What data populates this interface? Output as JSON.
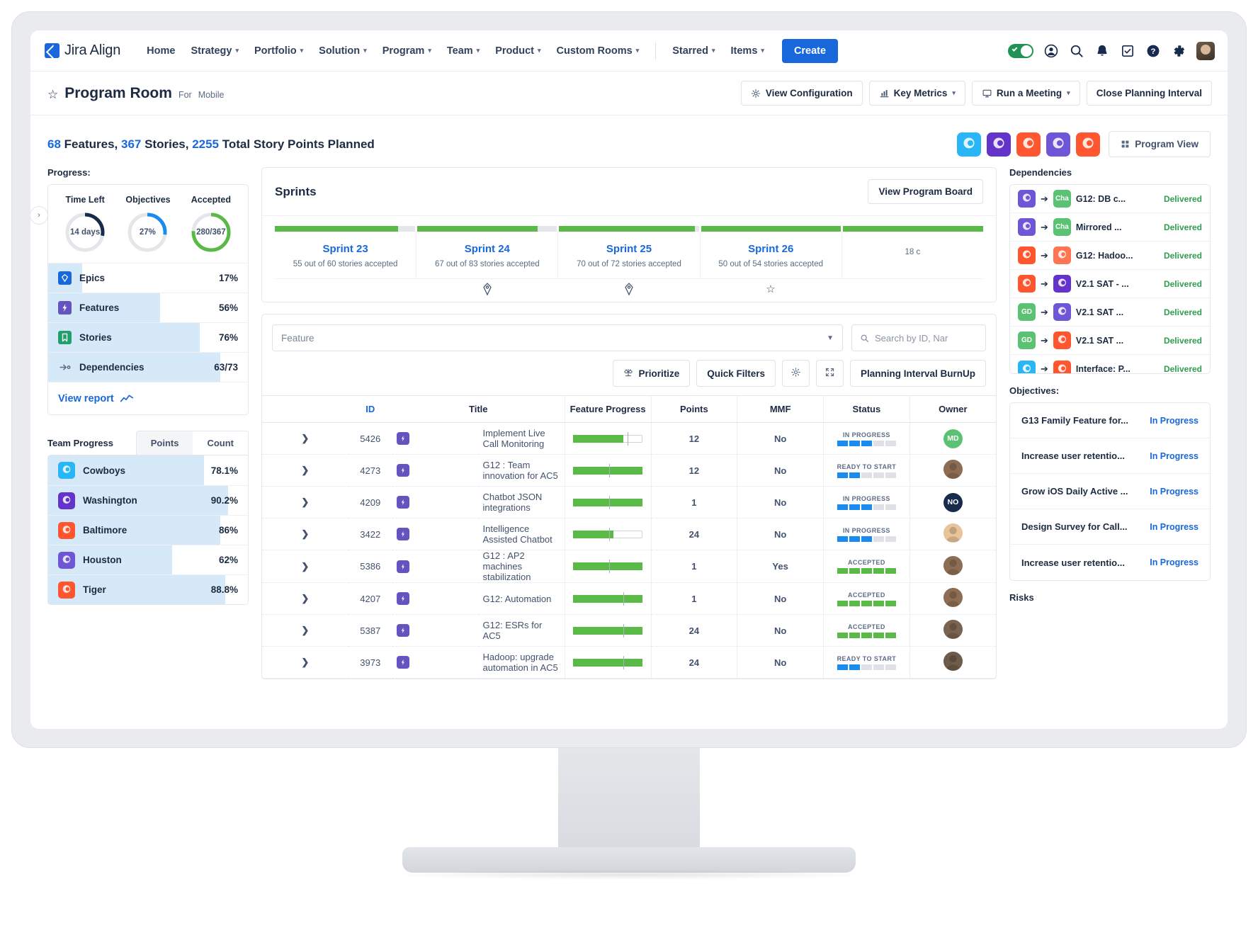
{
  "nav": {
    "brand": "Jira Align",
    "items": [
      {
        "label": "Home",
        "caret": false
      },
      {
        "label": "Strategy",
        "caret": true
      },
      {
        "label": "Portfolio",
        "caret": true
      },
      {
        "label": "Solution",
        "caret": true
      },
      {
        "label": "Program",
        "caret": true
      },
      {
        "label": "Team",
        "caret": true
      },
      {
        "label": "Product",
        "caret": true
      },
      {
        "label": "Custom Rooms",
        "caret": true
      }
    ],
    "items2": [
      {
        "label": "Starred",
        "caret": true
      },
      {
        "label": "Items",
        "caret": true
      }
    ],
    "create_label": "Create",
    "icons": [
      "toggle-switch",
      "account-icon",
      "search-icon",
      "notification-bell-icon",
      "tasks-checkbox-icon",
      "help-icon",
      "settings-gear-icon",
      "user-avatar"
    ]
  },
  "header": {
    "star_icon": "star-outline-icon",
    "title": "Program Room",
    "for_label": "For",
    "context": "Mobile",
    "actions": [
      {
        "label": "View Configuration",
        "icon": "gear-icon",
        "caret": false
      },
      {
        "label": "Key Metrics",
        "icon": "chart-icon",
        "caret": true
      },
      {
        "label": "Run a Meeting",
        "icon": "monitor-icon",
        "caret": true
      },
      {
        "label": "Close Planning Interval",
        "icon": "",
        "caret": false
      }
    ]
  },
  "summary": {
    "features_count": "68",
    "features_word": "Features,",
    "stories_count": "367",
    "stories_word": "Stories,",
    "points_count": "2255",
    "points_word": "Total Story Points Planned",
    "program_view_label": "Program View",
    "team_avatars": [
      {
        "name": "cowboys-avatar",
        "color": "#29b6f6"
      },
      {
        "name": "washington-avatar",
        "color": "#6433c9"
      },
      {
        "name": "baltimore-avatar",
        "color": "#ff5630"
      },
      {
        "name": "houston-avatar",
        "color": "#6f56d6"
      },
      {
        "name": "tiger-avatar",
        "color": "#ff5630"
      }
    ]
  },
  "progress": {
    "label": "Progress:",
    "donuts": [
      {
        "label": "Time Left",
        "value": "14 days",
        "pct": 28,
        "color": "#172b4d"
      },
      {
        "label": "Objectives",
        "value": "27%",
        "pct": 27,
        "color": "#1a8bef"
      },
      {
        "label": "Accepted",
        "value": "280/367",
        "pct": 76,
        "color": "#5aba47"
      }
    ],
    "rows": [
      {
        "icon": "epic-icon",
        "icon_color": "#1868db",
        "label": "Epics",
        "value": "17%",
        "fill": 17
      },
      {
        "icon": "feature-icon",
        "icon_color": "#6554c0",
        "label": "Features",
        "value": "56%",
        "fill": 56
      },
      {
        "icon": "story-icon",
        "icon_color": "#22a06b",
        "label": "Stories",
        "value": "76%",
        "fill": 76
      },
      {
        "icon": "dependency-icon",
        "icon_color": "#5b6b86",
        "label": "Dependencies",
        "value": "63/73",
        "fill": 86
      }
    ],
    "view_report_label": "View report",
    "view_report_icon": "trend-chart-icon"
  },
  "team_progress": {
    "label": "Team Progress",
    "tabs": [
      {
        "label": "Points",
        "active": true
      },
      {
        "label": "Count",
        "active": false
      }
    ],
    "rows": [
      {
        "name": "Cowboys",
        "value": "78.1%",
        "fill": 78.1,
        "color": "#29b6f6"
      },
      {
        "name": "Washington",
        "value": "90.2%",
        "fill": 90.2,
        "color": "#6433c9"
      },
      {
        "name": "Baltimore",
        "value": "86%",
        "fill": 86,
        "color": "#ff5630"
      },
      {
        "name": "Houston",
        "value": "62%",
        "fill": 62,
        "color": "#6f56d6"
      },
      {
        "name": "Tiger",
        "value": "88.8%",
        "fill": 88.8,
        "color": "#ff5630"
      }
    ]
  },
  "sprints": {
    "title": "Sprints",
    "view_board_label": "View Program Board",
    "cells": [
      {
        "name": "Sprint 23",
        "sub": "55 out of 60 stories accepted",
        "bar_pct": 88
      },
      {
        "name": "Sprint 24",
        "sub": "67 out of 83 stories accepted",
        "bar_pct": 86
      },
      {
        "name": "Sprint 25",
        "sub": "70 out of 72 stories accepted",
        "bar_pct": 97
      },
      {
        "name": "Sprint 26",
        "sub": "50 out of 54 stories accepted",
        "bar_pct": 100
      },
      {
        "name": "",
        "sub": "18 c",
        "bar_pct": 100
      }
    ],
    "markers": [
      "",
      "diamond",
      "diamond",
      "star",
      ""
    ]
  },
  "feature_table": {
    "type_filter_value": "Feature",
    "search_placeholder": "Search by ID, Nar",
    "buttons": [
      {
        "label": "Prioritize",
        "icon": "scales-icon"
      },
      {
        "label": "Quick Filters",
        "icon": ""
      },
      {
        "label": "",
        "icon": "gear-icon"
      },
      {
        "label": "",
        "icon": "expand-icon"
      },
      {
        "label": "Planning Interval BurnUp",
        "icon": ""
      }
    ],
    "columns": [
      "ID",
      "Title",
      "Feature Progress",
      "Points",
      "MMF",
      "Status",
      "Owner"
    ],
    "rows": [
      {
        "id": "5426",
        "title": "Implement Live Call Monitoring",
        "progress": 72,
        "tick": 78,
        "points": "12",
        "mmf": "No",
        "status": "IN PROGRESS",
        "status_segs": 3,
        "status_color": "blue",
        "owner": "MD",
        "owner_type": "initials",
        "owner_color": "#5bc274"
      },
      {
        "id": "4273",
        "title": "G12 : Team innovation for AC5",
        "progress": 100,
        "tick": 52,
        "points": "12",
        "mmf": "No",
        "status": "READY TO START",
        "status_segs": 2,
        "status_color": "blue",
        "owner": "",
        "owner_type": "photo",
        "owner_color": "#8d6e54"
      },
      {
        "id": "4209",
        "title": "Chatbot JSON integrations",
        "progress": 100,
        "tick": 52,
        "points": "1",
        "mmf": "No",
        "status": "IN PROGRESS",
        "status_segs": 3,
        "status_color": "blue",
        "owner": "NO",
        "owner_type": "initials",
        "owner_color": "#172b4d"
      },
      {
        "id": "3422",
        "title": "Intelligence Assisted Chatbot",
        "progress": 58,
        "tick": 52,
        "points": "24",
        "mmf": "No",
        "status": "IN PROGRESS",
        "status_segs": 3,
        "status_color": "blue",
        "owner": "",
        "owner_type": "photo",
        "owner_color": "#e8c49a"
      },
      {
        "id": "5386",
        "title": "G12 : AP2 machines stabilization",
        "progress": 100,
        "tick": 52,
        "points": "1",
        "mmf": "Yes",
        "status": "ACCEPTED",
        "status_segs": 5,
        "status_color": "green",
        "owner": "",
        "owner_type": "photo",
        "owner_color": "#8d6e54"
      },
      {
        "id": "4207",
        "title": "G12: Automation",
        "progress": 100,
        "tick": 72,
        "points": "1",
        "mmf": "No",
        "status": "ACCEPTED",
        "status_segs": 5,
        "status_color": "green",
        "owner": "",
        "owner_type": "photo",
        "owner_color": "#8d6e54"
      },
      {
        "id": "5387",
        "title": "G12: ESRs for AC5",
        "progress": 100,
        "tick": 72,
        "points": "24",
        "mmf": "No",
        "status": "ACCEPTED",
        "status_segs": 5,
        "status_color": "green",
        "owner": "",
        "owner_type": "photo",
        "owner_color": "#7b6352"
      },
      {
        "id": "3973",
        "title": "Hadoop: upgrade automation in AC5",
        "progress": 100,
        "tick": 72,
        "points": "24",
        "mmf": "No",
        "status": "READY TO START",
        "status_segs": 2,
        "status_color": "blue",
        "owner": "",
        "owner_type": "photo",
        "owner_color": "#6f5b49"
      }
    ]
  },
  "dependencies": {
    "label": "Dependencies",
    "rows": [
      {
        "from": "houston-avatar",
        "from_color": "#6f56d6",
        "from_text": "",
        "to": "Cha",
        "to_color": "#5bc274",
        "to_text": "Cha",
        "title": "G12: DB c...",
        "status": "Delivered"
      },
      {
        "from": "houston-avatar",
        "from_color": "#6f56d6",
        "from_text": "",
        "to": "Cha",
        "to_color": "#5bc274",
        "to_text": "Cha",
        "title": "Mirrored ...",
        "status": "Delivered"
      },
      {
        "from": "baltimore-avatar",
        "from_color": "#ff5630",
        "from_text": "",
        "to": "cloud",
        "to_color": "#ff7452",
        "to_text": "",
        "title": "G12: Hadoo...",
        "status": "Delivered"
      },
      {
        "from": "baltimore-avatar",
        "from_color": "#ff5630",
        "from_text": "",
        "to": "washington",
        "to_color": "#6433c9",
        "to_text": "",
        "title": "V2.1 SAT - ...",
        "status": "Delivered"
      },
      {
        "from": "GD",
        "from_color": "#5bc274",
        "from_text": "GD",
        "to": "houston",
        "to_color": "#6f56d6",
        "to_text": "",
        "title": "V2.1 SAT ...",
        "status": "Delivered"
      },
      {
        "from": "GD",
        "from_color": "#5bc274",
        "from_text": "GD",
        "to": "baltimore",
        "to_color": "#ff5630",
        "to_text": "",
        "title": "V2.1 SAT ...",
        "status": "Delivered"
      },
      {
        "from": "cowboys",
        "from_color": "#29b6f6",
        "from_text": "",
        "to": "interface",
        "to_color": "#ff5630",
        "to_text": "",
        "title": "Interface: P...",
        "status": "Delivered"
      }
    ]
  },
  "objectives": {
    "label": "Objectives:",
    "rows": [
      {
        "title": "G13 Family Feature for...",
        "status": "In Progress"
      },
      {
        "title": "Increase user retentio...",
        "status": "In Progress"
      },
      {
        "title": "Grow iOS Daily Active ...",
        "status": "In Progress"
      },
      {
        "title": "Design Survey for Call...",
        "status": "In Progress"
      },
      {
        "title": "Increase user retentio...",
        "status": "In Progress"
      }
    ]
  },
  "risks": {
    "label": "Risks"
  }
}
